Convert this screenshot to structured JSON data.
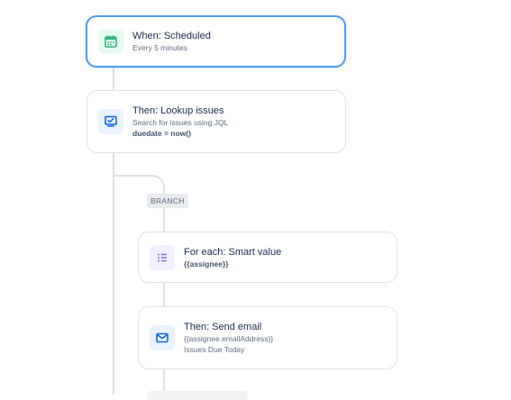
{
  "nodes": {
    "trigger": {
      "title": "When: Scheduled",
      "subtitle": "Every 5 minutes",
      "icon": "calendar-icon",
      "color": "#36b37e"
    },
    "lookup": {
      "title": "Then: Lookup issues",
      "subtitle": "Search for issues using JQL",
      "query": "duedate = now()",
      "icon": "monitor-check-icon",
      "color": "#0c66e4"
    },
    "branch": {
      "label": "BRANCH"
    },
    "foreach": {
      "title": "For each: Smart value",
      "subtitle": "{{assignee}}",
      "icon": "list-icon",
      "color": "#8270db"
    },
    "email": {
      "title": "Then: Send email",
      "subtitle": "{{assignee.emailAddress}}",
      "detail": "Issues Due Today",
      "icon": "mail-icon",
      "color": "#0c66e4"
    }
  },
  "colors": {
    "connector": "#dfe1e6",
    "selected_border": "#4c9aff"
  }
}
